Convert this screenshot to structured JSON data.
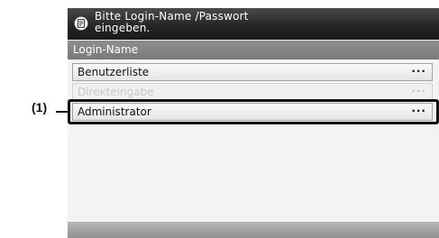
{
  "callout": {
    "label": "(1)"
  },
  "header": {
    "icon": "key-card-icon",
    "message": "Bitte Login-Name /Passwort\neingeben."
  },
  "section": {
    "title": "Login-Name"
  },
  "list": {
    "items": [
      {
        "label": "Benutzerliste",
        "more": "···",
        "state": "normal"
      },
      {
        "label": "Direkteingabe",
        "more": "···",
        "state": "disabled"
      },
      {
        "label": "Administrator",
        "more": "···",
        "state": "selected"
      }
    ]
  },
  "colors": {
    "header_bg": "#262626",
    "section_bg": "#7f7f7f",
    "screen_bg": "#eeeeee",
    "selection_frame": "#111111"
  }
}
